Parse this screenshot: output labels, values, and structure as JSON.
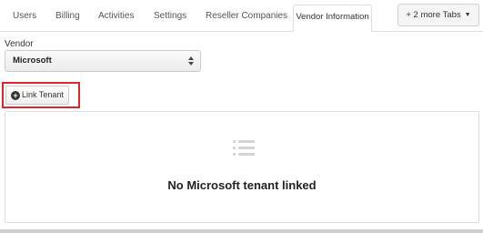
{
  "tabs": [
    {
      "label": "Users"
    },
    {
      "label": "Billing"
    },
    {
      "label": "Activities"
    },
    {
      "label": "Settings"
    },
    {
      "label": "Reseller Companies"
    },
    {
      "label": "Vendor Information",
      "active": true
    }
  ],
  "more_tabs_label": "+ 2 more Tabs",
  "vendor": {
    "label": "Vendor",
    "selected": "Microsoft"
  },
  "link_tenant_label": "Link Tenant",
  "empty_state": {
    "message": "No Microsoft tenant linked",
    "icon": "list-icon"
  },
  "colors": {
    "highlight": "#e0252b"
  }
}
